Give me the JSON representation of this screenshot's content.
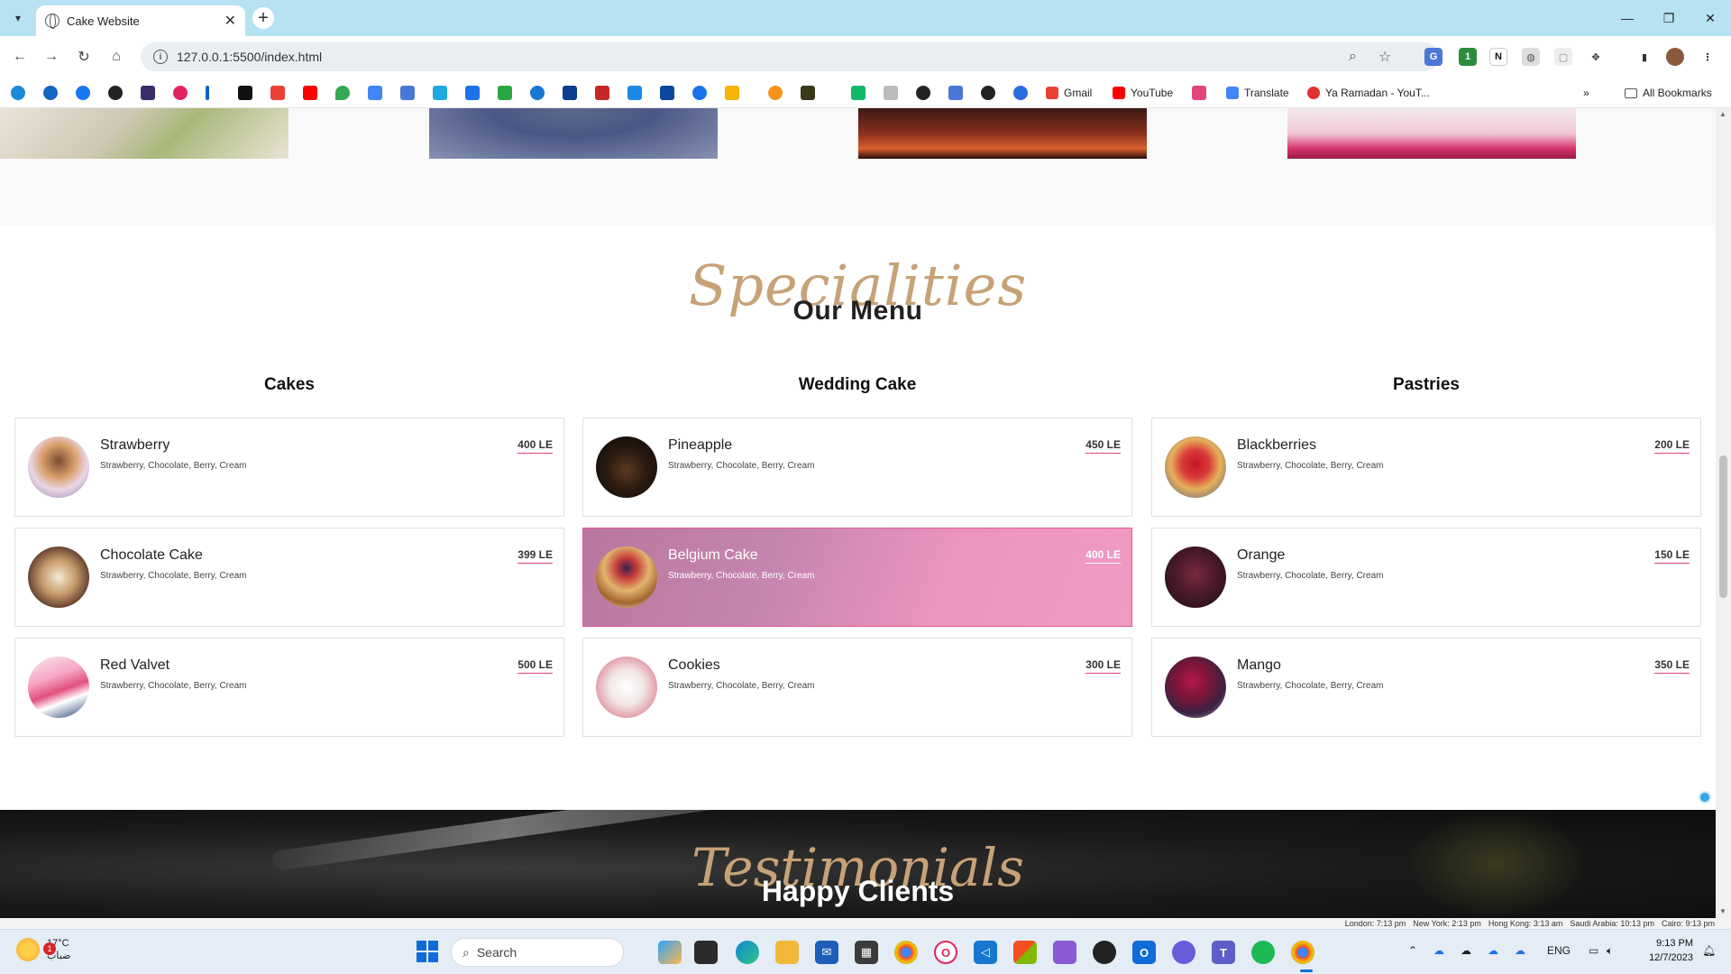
{
  "browser": {
    "tab_title": "Cake Website",
    "url": "127.0.0.1:5500/index.html",
    "bookmarks": [
      {
        "label": "Gmail",
        "color": "#ea4335"
      },
      {
        "label": "YouTube",
        "color": "#ff0000"
      },
      {
        "label": "Translate",
        "color": "#4285f4"
      },
      {
        "label": "Ya Ramadan - YouT...",
        "color": "#e03131"
      }
    ],
    "all_bookmarks": "All Bookmarks"
  },
  "page": {
    "menu_script": "Specialities",
    "menu_title": "Our Menu",
    "columns": [
      {
        "title": "Cakes",
        "items": [
          {
            "name": "Strawberry",
            "desc": "Strawberry, Chocolate, Berry, Cream",
            "price": "400 LE"
          },
          {
            "name": "Chocolate Cake",
            "desc": "Strawberry, Chocolate, Berry, Cream",
            "price": "399 LE"
          },
          {
            "name": "Red Valvet",
            "desc": "Strawberry, Chocolate, Berry, Cream",
            "price": "500 LE"
          }
        ]
      },
      {
        "title": "Wedding Cake",
        "items": [
          {
            "name": "Pineapple",
            "desc": "Strawberry, Chocolate, Berry, Cream",
            "price": "450 LE"
          },
          {
            "name": "Belgium Cake",
            "desc": "Strawberry, Chocolate, Berry, Cream",
            "price": "400 LE",
            "active": true
          },
          {
            "name": "Cookies",
            "desc": "Strawberry, Chocolate, Berry, Cream",
            "price": "300 LE"
          }
        ]
      },
      {
        "title": "Pastries",
        "items": [
          {
            "name": "Blackberries",
            "desc": "Strawberry, Chocolate, Berry, Cream",
            "price": "200 LE"
          },
          {
            "name": "Orange",
            "desc": "Strawberry, Chocolate, Berry, Cream",
            "price": "150 LE"
          },
          {
            "name": "Mango",
            "desc": "Strawberry, Chocolate, Berry, Cream",
            "price": "350 LE"
          }
        ]
      }
    ],
    "testimonials_script": "Testimonials",
    "testimonials_title": "Happy Clients"
  },
  "world_clocks": [
    "London: 7:13 pm",
    "New York: 2:13 pm",
    "Hong Kong: 3:13 am",
    "Saudi Arabia: 10:13 pm",
    "Cairo: 9:13 pm"
  ],
  "taskbar": {
    "weather_temp": "17°C",
    "weather_desc": "ضباب",
    "weather_badge": "1",
    "search_placeholder": "Search",
    "language": "ENG",
    "time": "9:13 PM",
    "date": "12/7/2023"
  },
  "colors": {
    "accent_gold": "#c7a277",
    "active_card_pink": "#ec94c0",
    "price_underline": "#e0457b"
  }
}
